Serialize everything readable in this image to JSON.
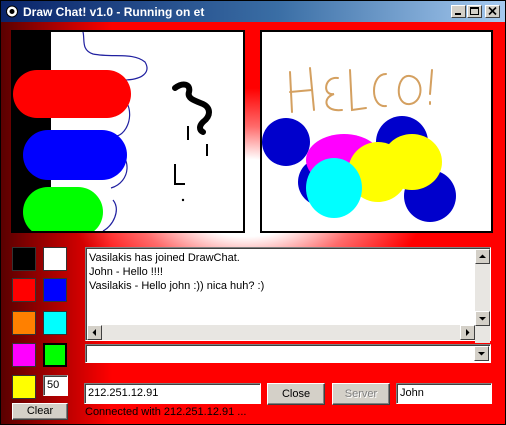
{
  "window": {
    "title": "Draw Chat! v1.0 - Running on et"
  },
  "colors": {
    "palette": [
      "#000000",
      "#ffffff",
      "#ff0000",
      "#0000ff",
      "#ff8000",
      "#00ffff",
      "#ff00ff",
      "#00ff00",
      "#ffff00"
    ],
    "accent_red": "#ff0000"
  },
  "brush": {
    "size": "50"
  },
  "toolbar": {
    "clear_label": "Clear"
  },
  "chat": {
    "messages": [
      "Vasilakis has joined DrawChat.",
      "John - Hello !!!!",
      "Vasilakis - Hello john :)) nica huh? :)"
    ],
    "input_value": ""
  },
  "connection": {
    "ip_value": "212.251.12.91",
    "close_label": "Close",
    "server_label": "Server",
    "name_value": "John",
    "status": "Connected with 212.251.12.91 ..."
  },
  "icons": {
    "app": "draw-chat-app-icon",
    "minimize": "minimize-icon",
    "maximize": "maximize-icon",
    "close": "close-icon"
  }
}
